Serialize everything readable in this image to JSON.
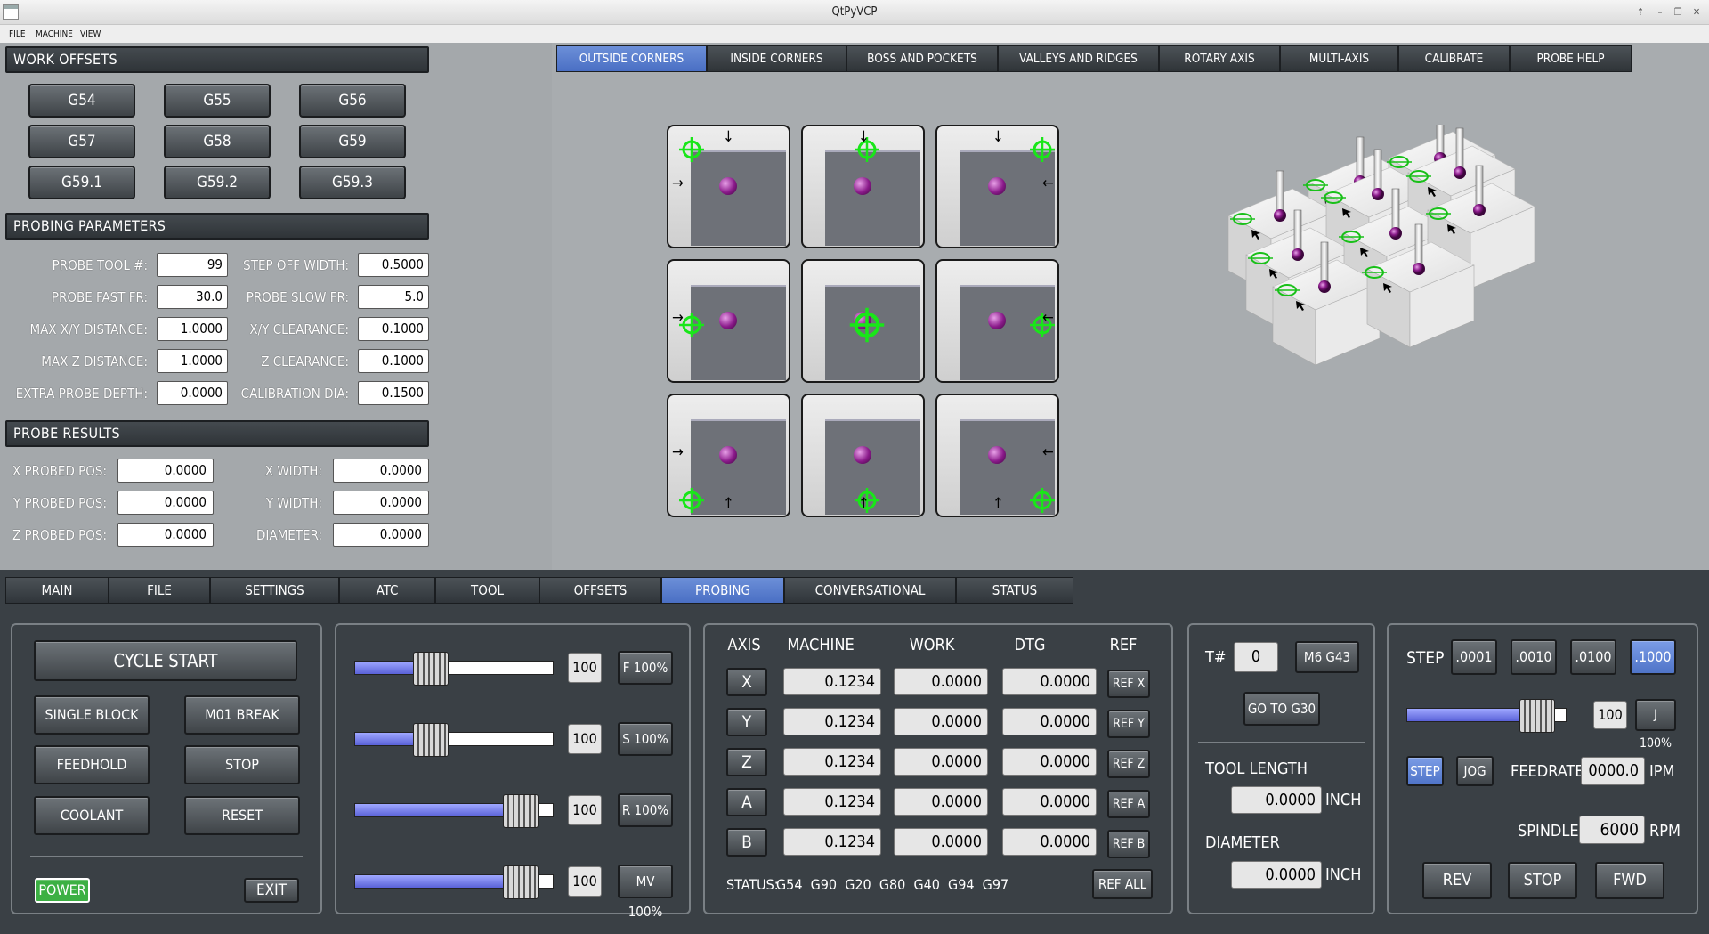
{
  "window": {
    "title": "QtPyVCP"
  },
  "menu": [
    "FILE",
    "MACHINE",
    "VIEW"
  ],
  "work_offsets": {
    "header": "WORK OFFSETS",
    "buttons": [
      "G54",
      "G55",
      "G56",
      "G57",
      "G58",
      "G59",
      "G59.1",
      "G59.2",
      "G59.3"
    ]
  },
  "probing_parameters": {
    "header": "PROBING PARAMETERS",
    "rows": [
      {
        "l1": "PROBE TOOL #:",
        "v1": "99",
        "l2": "STEP OFF WIDTH:",
        "v2": "0.5000"
      },
      {
        "l1": "PROBE FAST FR:",
        "v1": "30.0",
        "l2": "PROBE SLOW FR:",
        "v2": "5.0"
      },
      {
        "l1": "MAX X/Y DISTANCE:",
        "v1": "1.0000",
        "l2": "X/Y CLEARANCE:",
        "v2": "0.1000"
      },
      {
        "l1": "MAX Z DISTANCE:",
        "v1": "1.0000",
        "l2": "Z CLEARANCE:",
        "v2": "0.1000"
      },
      {
        "l1": "EXTRA PROBE DEPTH:",
        "v1": "0.0000",
        "l2": "CALIBRATION DIA:",
        "v2": "0.1500"
      }
    ]
  },
  "probe_results": {
    "header": "PROBE RESULTS",
    "rows": [
      {
        "l1": "X PROBED POS:",
        "v1": "0.0000",
        "l2": "X WIDTH:",
        "v2": "0.0000"
      },
      {
        "l1": "Y PROBED POS:",
        "v1": "0.0000",
        "l2": "Y WIDTH:",
        "v2": "0.0000"
      },
      {
        "l1": "Z PROBED POS:",
        "v1": "0.0000",
        "l2": "DIAMETER:",
        "v2": "0.0000"
      }
    ]
  },
  "probe_tabs": [
    "OUTSIDE CORNERS",
    "INSIDE CORNERS",
    "BOSS AND POCKETS",
    "VALLEYS AND RIDGES",
    "ROTARY AXIS",
    "MULTI-AXIS",
    "CALIBRATE",
    "PROBE HELP"
  ],
  "probe_tabs_active": "OUTSIDE CORNERS",
  "main_tabs": [
    "MAIN",
    "FILE",
    "SETTINGS",
    "ATC",
    "TOOL",
    "OFFSETS",
    "PROBING",
    "CONVERSATIONAL",
    "STATUS"
  ],
  "main_tabs_active": "PROBING",
  "control": {
    "cycle_start": "CYCLE START",
    "single_block": "SINGLE BLOCK",
    "m01_break": "M01 BREAK",
    "feedhold": "FEEDHOLD",
    "stop": "STOP",
    "coolant": "COOLANT",
    "reset": "RESET",
    "power": "POWER",
    "exit": "EXIT"
  },
  "overrides": [
    {
      "value": "100",
      "button": "F 100%",
      "level": 0.45
    },
    {
      "value": "100",
      "button": "S 100%",
      "level": 0.45
    },
    {
      "value": "100",
      "button": "R 100%",
      "level": 0.9
    },
    {
      "value": "100",
      "button": "MV 100%",
      "level": 0.9
    }
  ],
  "dro": {
    "headers": [
      "AXIS",
      "MACHINE",
      "WORK",
      "DTG",
      "REF"
    ],
    "rows": [
      {
        "axis": "X",
        "machine": "0.1234",
        "work": "0.0000",
        "dtg": "0.0000",
        "ref": "REF X"
      },
      {
        "axis": "Y",
        "machine": "0.1234",
        "work": "0.0000",
        "dtg": "0.0000",
        "ref": "REF Y"
      },
      {
        "axis": "Z",
        "machine": "0.1234",
        "work": "0.0000",
        "dtg": "0.0000",
        "ref": "REF Z"
      },
      {
        "axis": "A",
        "machine": "0.1234",
        "work": "0.0000",
        "dtg": "0.0000",
        "ref": "REF A"
      },
      {
        "axis": "B",
        "machine": "0.1234",
        "work": "0.0000",
        "dtg": "0.0000",
        "ref": "REF B"
      }
    ],
    "status_label": "STATUS:",
    "gcodes": "G54  G90  G20  G80  G40  G94  G97",
    "ref_all": "REF ALL"
  },
  "tool": {
    "t_label": "T#",
    "t_value": "0",
    "m6_button": "M6 G43",
    "g30_button": "GO TO G30",
    "length_label": "TOOL LENGTH",
    "length_value": "0.0000",
    "length_unit": "INCH",
    "diameter_label": "DIAMETER",
    "diameter_value": "0.0000",
    "diameter_unit": "INCH"
  },
  "jog": {
    "step_label": "STEP",
    "steps": [
      ".0001",
      ".0010",
      ".0100",
      ".1000"
    ],
    "step_active": ".1000",
    "jog_value": "100",
    "jog_button": "J 100%",
    "jog_level": 0.9,
    "mode_step": "STEP",
    "mode_jog": "JOG",
    "feedrate_label": "FEEDRATE",
    "feedrate_value": "0000.0",
    "feedrate_unit": "IPM",
    "spindle_label": "SPINDLE",
    "spindle_value": "6000",
    "spindle_unit": "RPM",
    "rev": "REV",
    "stop": "STOP",
    "fwd": "FWD"
  },
  "colors": {
    "accent": "#5a7ed0",
    "power": "#3cb043",
    "panel_bg": "#3a4045",
    "upper_bg": "#a6aaad"
  }
}
